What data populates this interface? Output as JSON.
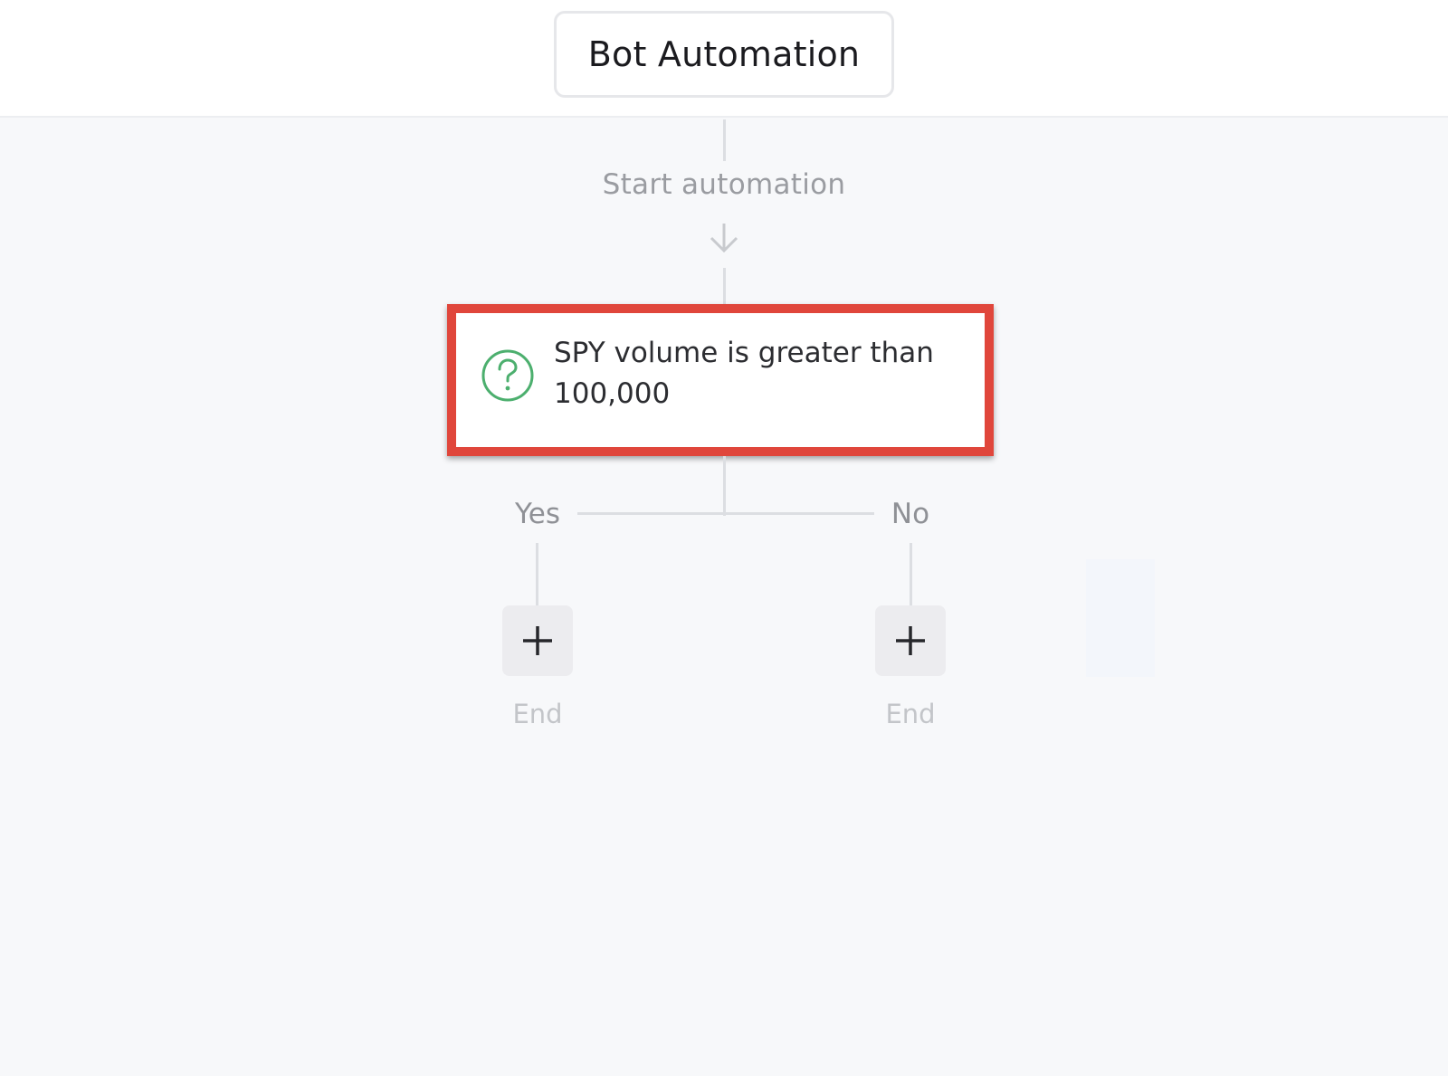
{
  "header": {
    "title": "Bot Automation"
  },
  "flow": {
    "start_label": "Start automation",
    "arrow_icon": "arrow-down-icon",
    "condition": {
      "icon": "question-circle-icon",
      "text": "SPY volume is greater than 100,000",
      "icon_color": "#4caf6e",
      "highlight_color": "#e0463b"
    },
    "branches": {
      "yes": {
        "label": "Yes",
        "add_icon": "plus-icon",
        "end_label": "End"
      },
      "no": {
        "label": "No",
        "add_icon": "plus-icon",
        "end_label": "End"
      }
    }
  }
}
